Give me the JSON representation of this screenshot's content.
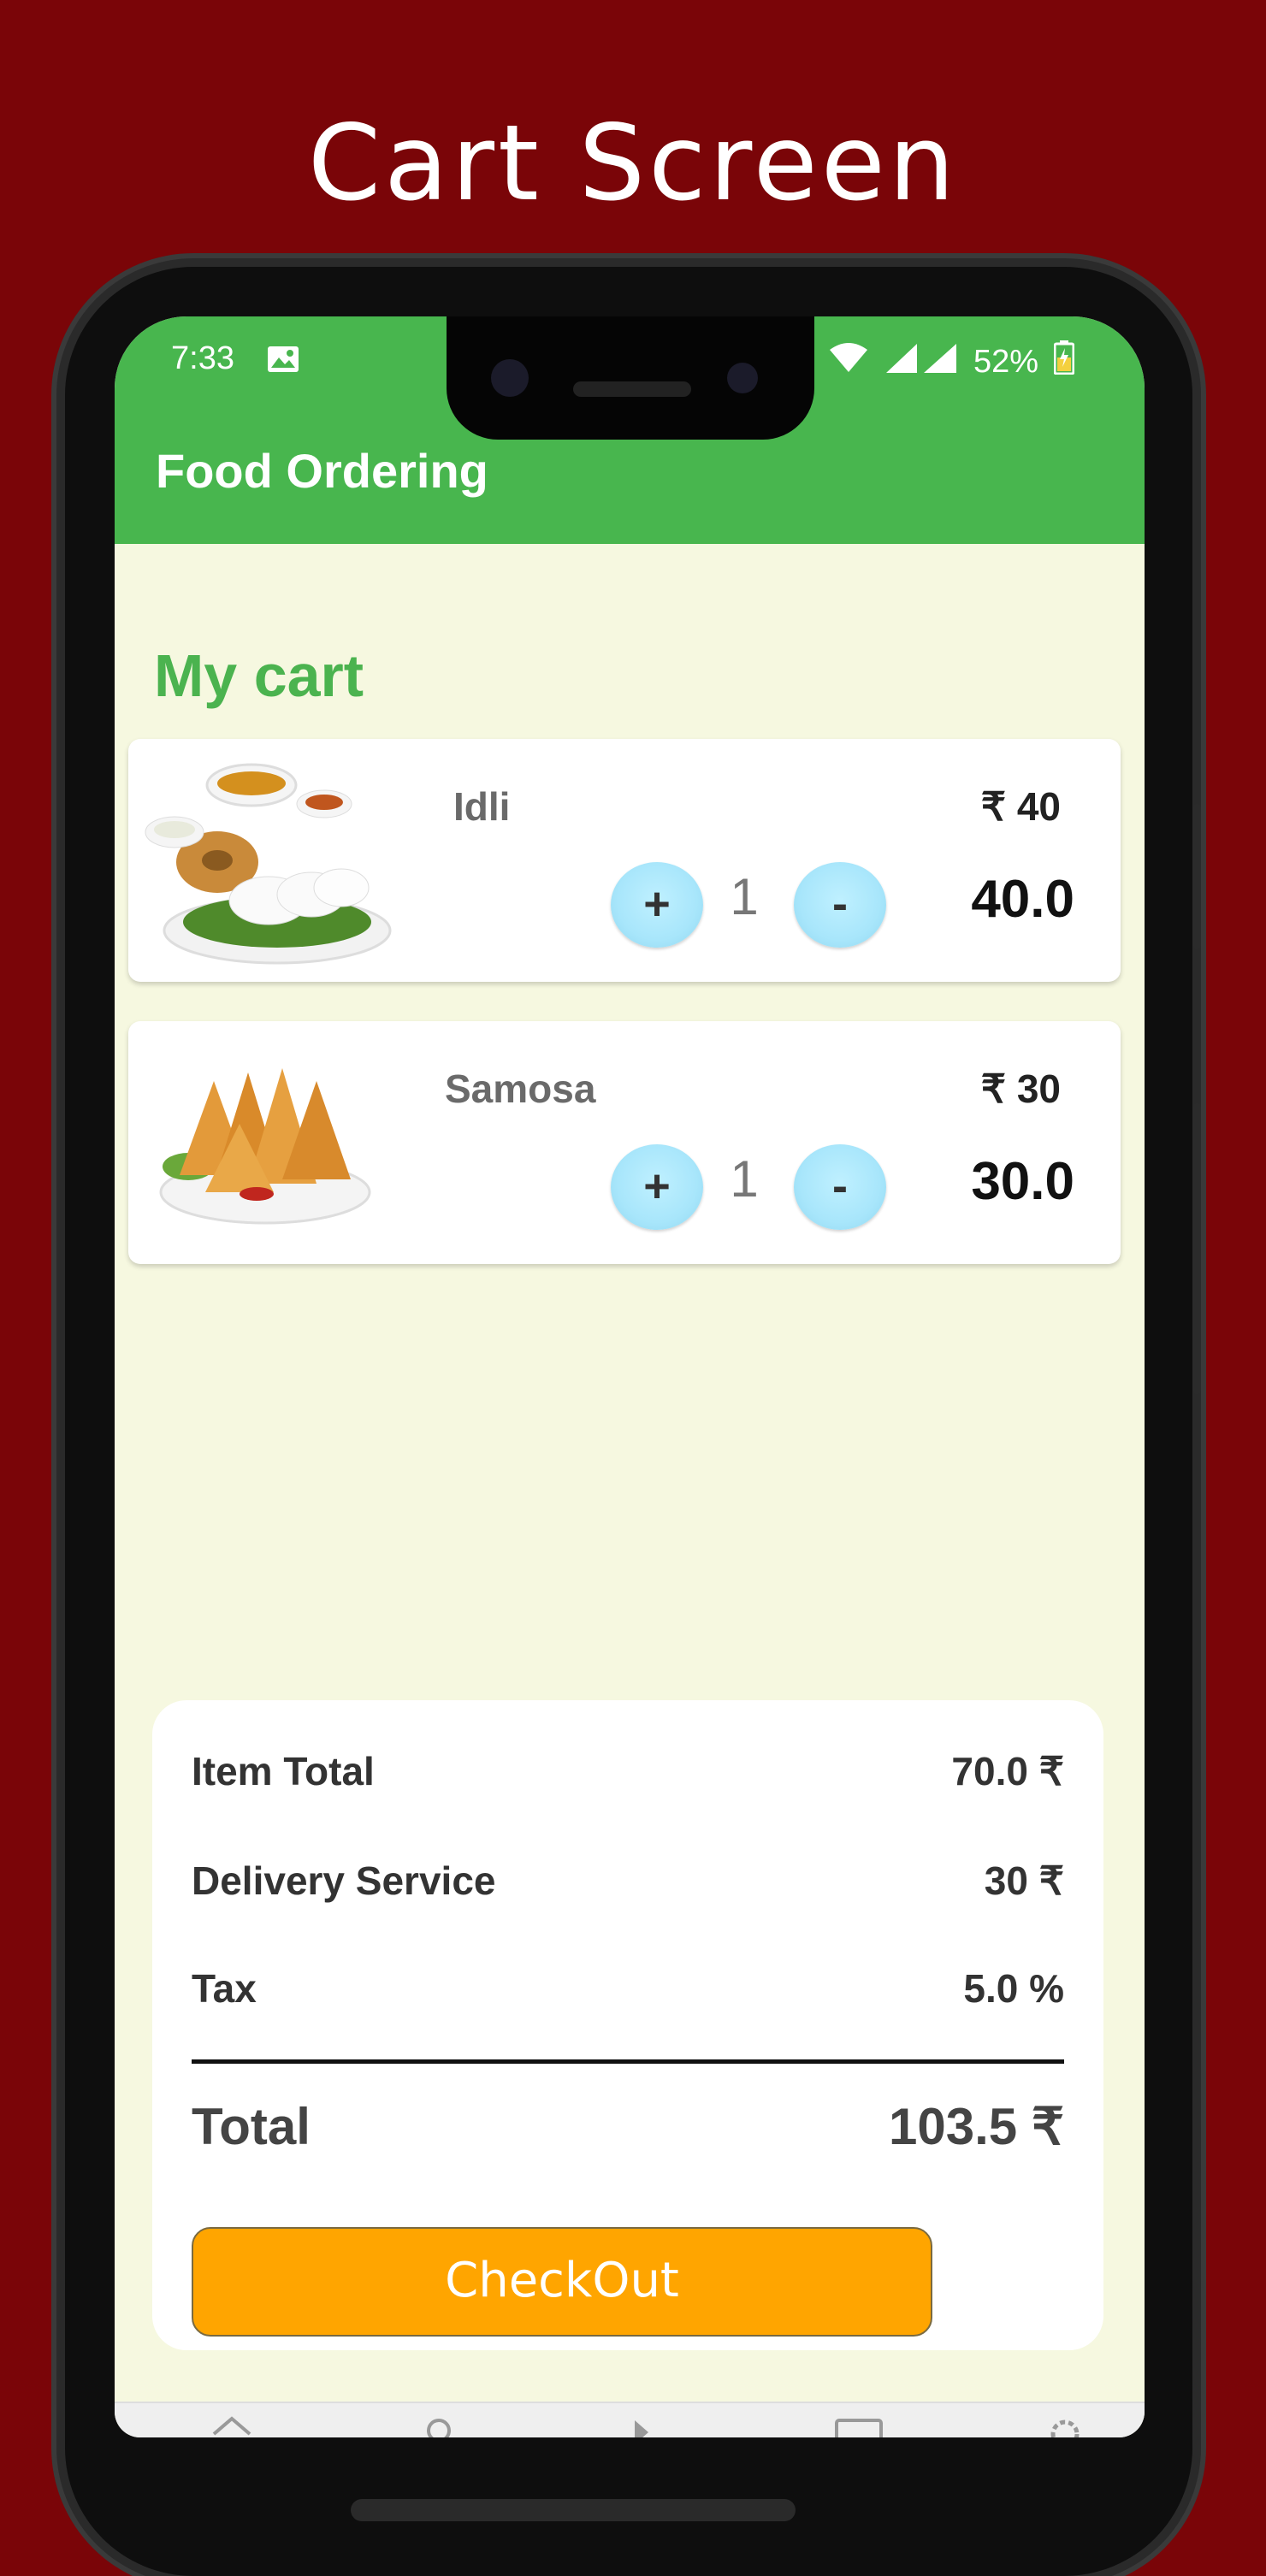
{
  "promo": {
    "title": "Cart Screen"
  },
  "status_bar": {
    "time": "7:33",
    "battery": "52%"
  },
  "app_bar": {
    "title": "Food Ordering"
  },
  "cart": {
    "heading": "My cart",
    "items": [
      {
        "name": "Idli",
        "price": "₹ 40",
        "plus_label": "+",
        "quantity": "1",
        "minus_label": "-",
        "total": "40.0"
      },
      {
        "name": "Samosa",
        "price": "₹ 30",
        "plus_label": "+",
        "quantity": "1",
        "minus_label": "-",
        "total": "30.0"
      }
    ]
  },
  "summary": {
    "item_total_label": "Item Total",
    "item_total_value": "70.0 ₹",
    "delivery_label": "Delivery Service",
    "delivery_value": "30 ₹",
    "tax_label": "Tax",
    "tax_value": "5.0 %",
    "total_label": "Total",
    "total_value": "103.5 ₹",
    "checkout_label": "CheckOut"
  },
  "colors": {
    "background": "#7a0508",
    "app_bar": "#48b64e",
    "screen_bg": "#f6f8e0",
    "heading_green": "#4bb34f",
    "checkout_orange": "#ffa500",
    "qty_button": "#a8e6fb"
  },
  "icons": {
    "status": [
      "image-icon",
      "wifi-icon",
      "signal-icon",
      "battery-charging-icon"
    ],
    "bottom_nav": [
      "home-icon",
      "search-icon",
      "play-icon",
      "tablet-icon",
      "settings-icon"
    ]
  }
}
